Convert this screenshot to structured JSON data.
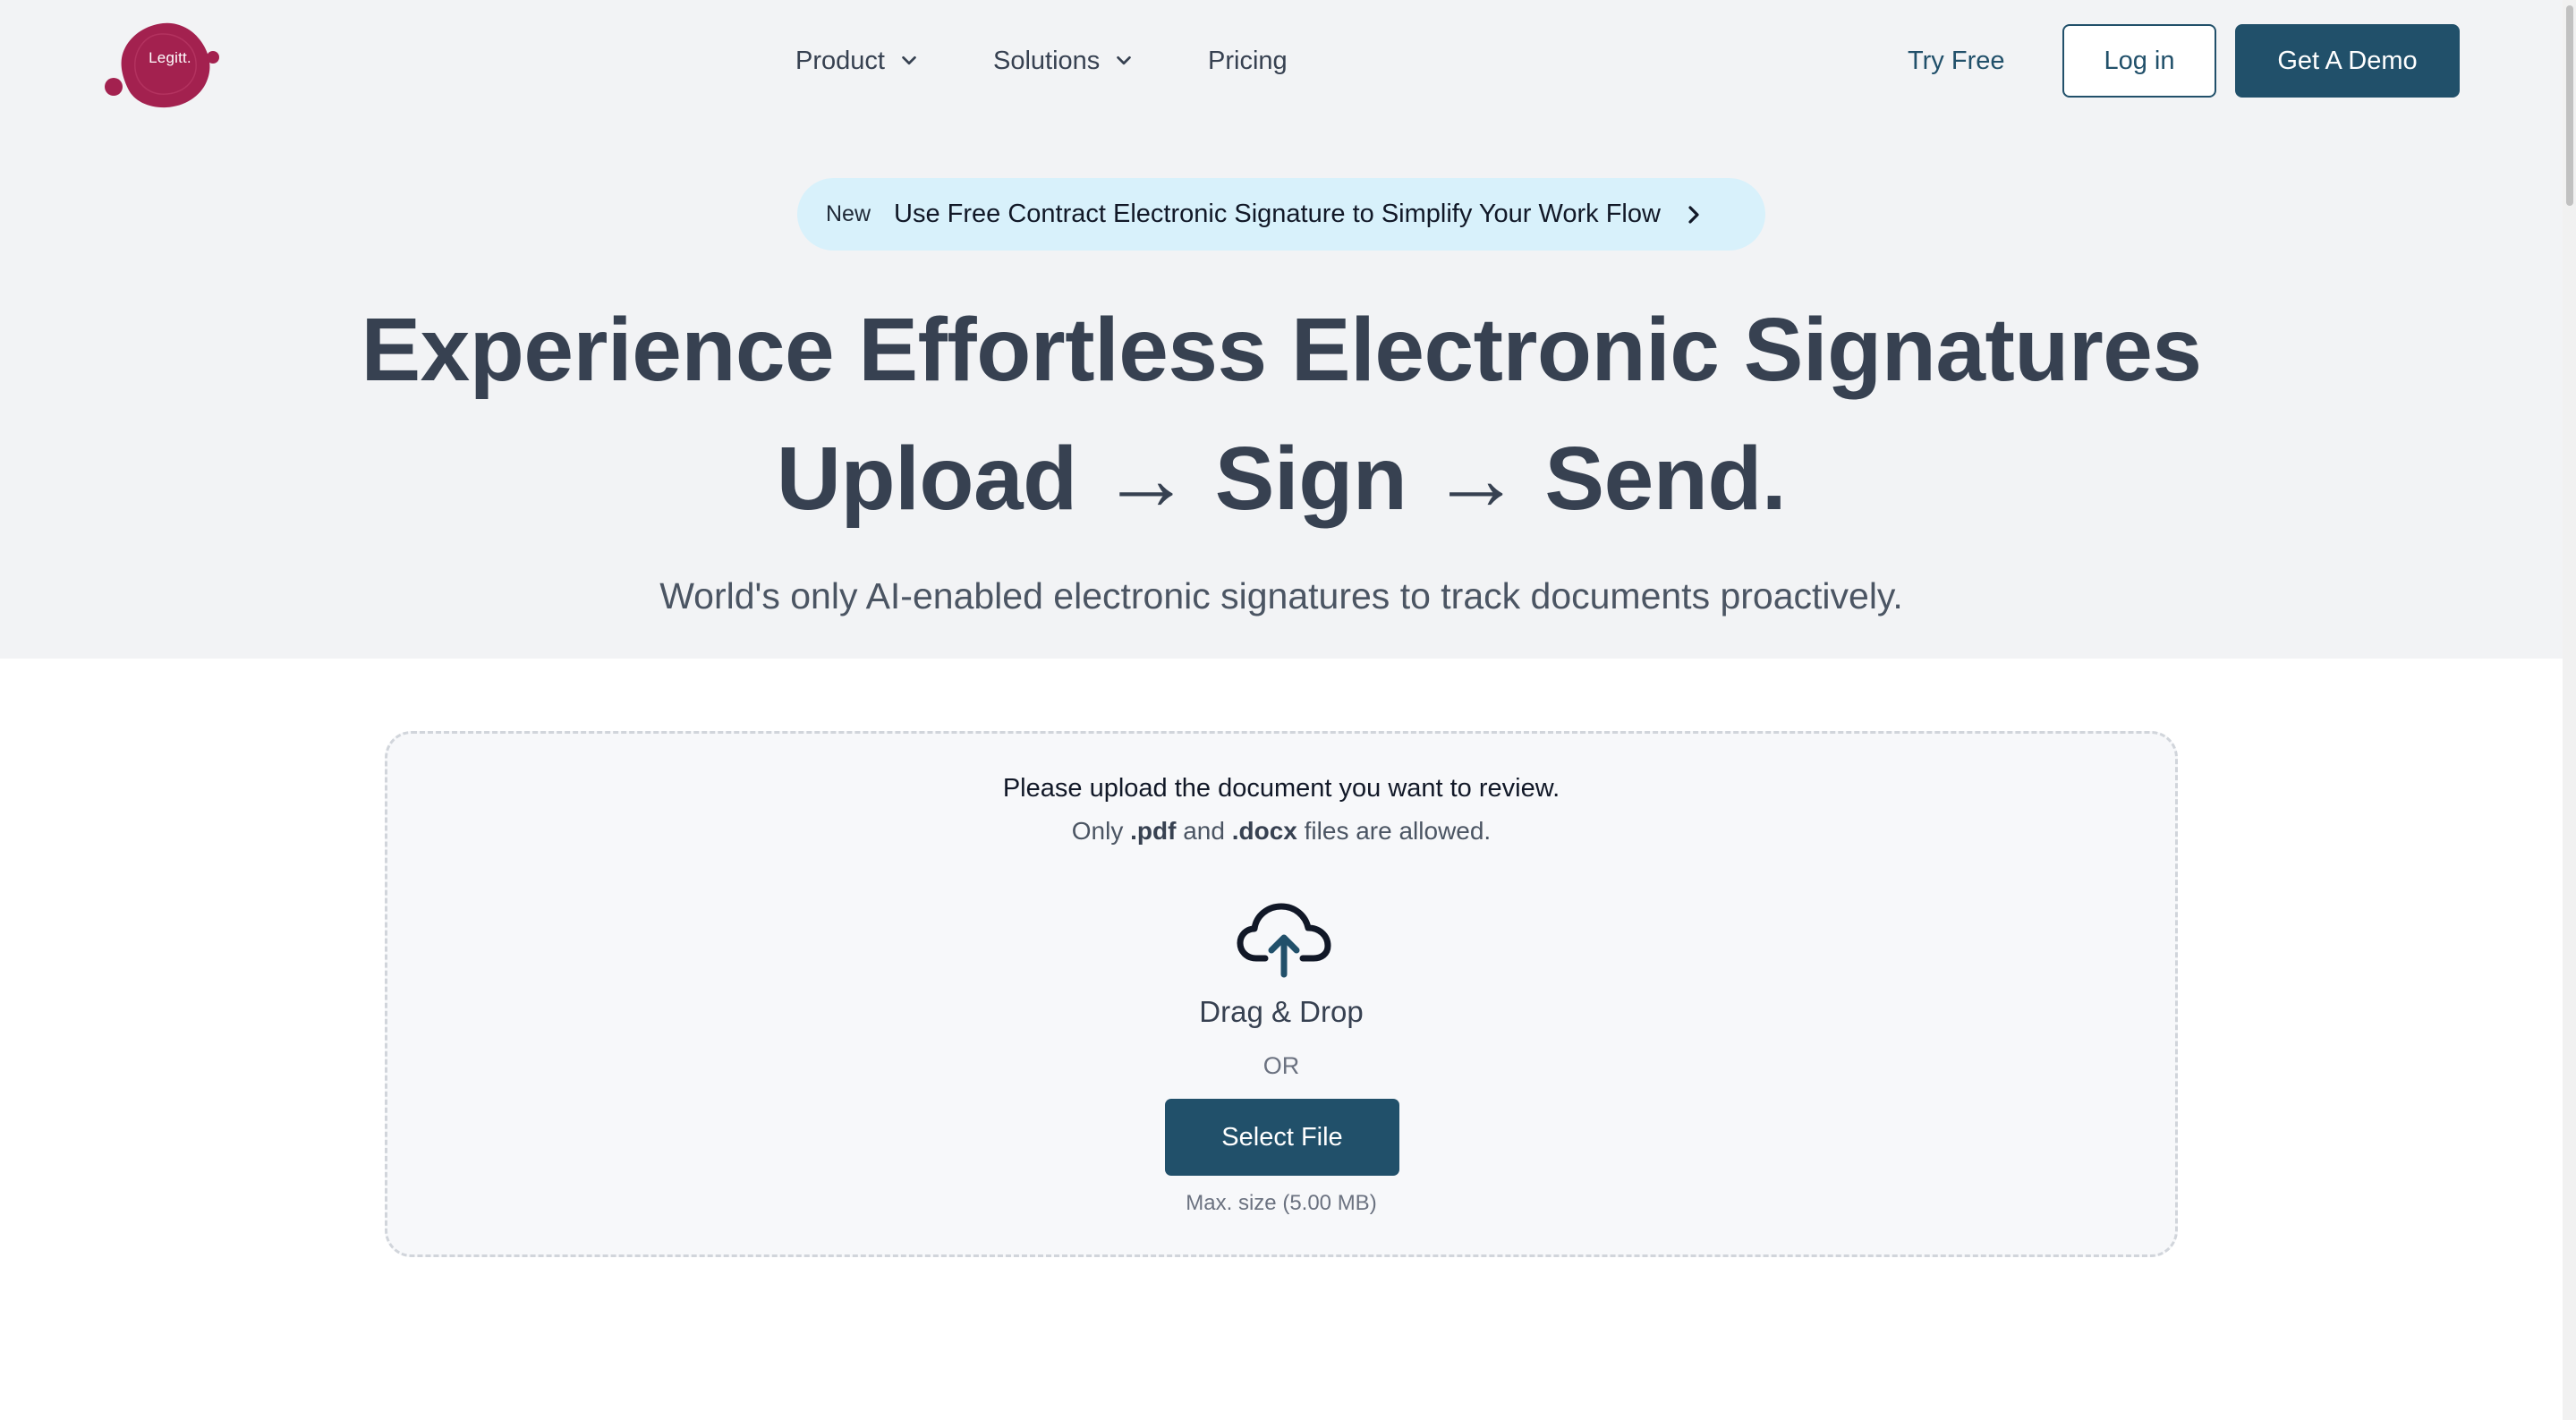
{
  "nav": {
    "logo_text": "Legitt.",
    "items": [
      {
        "label": "Product",
        "has_dropdown": true
      },
      {
        "label": "Solutions",
        "has_dropdown": true
      },
      {
        "label": "Pricing",
        "has_dropdown": false
      }
    ],
    "try_free_label": "Try Free",
    "login_label": "Log in",
    "demo_label": "Get A Demo"
  },
  "announcement": {
    "badge": "New",
    "text": "Use Free Contract Electronic Signature to Simplify Your Work Flow",
    "icon": "chevron-right-icon"
  },
  "hero": {
    "headline_line1": "Experience Effortless Electronic Signatures",
    "headline_line2": "Upload → Sign → Send.",
    "subtitle": "World's only AI-enabled electronic signatures to track documents proactively."
  },
  "upload": {
    "title": "Please upload the document you want to review.",
    "allowed_prefix": "Only",
    "allowed_ext1": ".pdf",
    "allowed_and": "and",
    "allowed_ext2": ".docx",
    "allowed_suffix": "files are allowed.",
    "icon": "cloud-upload-icon",
    "drag_label": "Drag & Drop",
    "or_label": "OR",
    "select_label": "Select File",
    "max_size": "Max. size (5.00 MB)"
  },
  "colors": {
    "brand": "#21506a",
    "logo": "#a3214f",
    "hero_bg": "#f2f3f5",
    "announce_bg": "#d8f1fb"
  }
}
